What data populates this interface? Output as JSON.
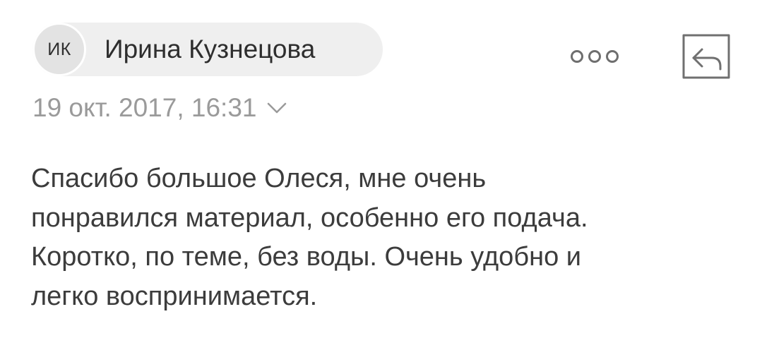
{
  "sender": {
    "initials": "ИК",
    "name": "Ирина Кузнецова"
  },
  "header": {
    "more_icon": "more-dots-icon",
    "reply_icon": "reply-icon"
  },
  "message": {
    "datetime": "19 окт. 2017, 16:31",
    "details_icon": "chevron-down-icon",
    "body_lines": [
      "Спасибо большое Олеся, мне очень",
      "понравился материал, особенно его подача.",
      "Коротко, по теме, без воды. Очень удобно и",
      "легко воспринимается."
    ]
  }
}
